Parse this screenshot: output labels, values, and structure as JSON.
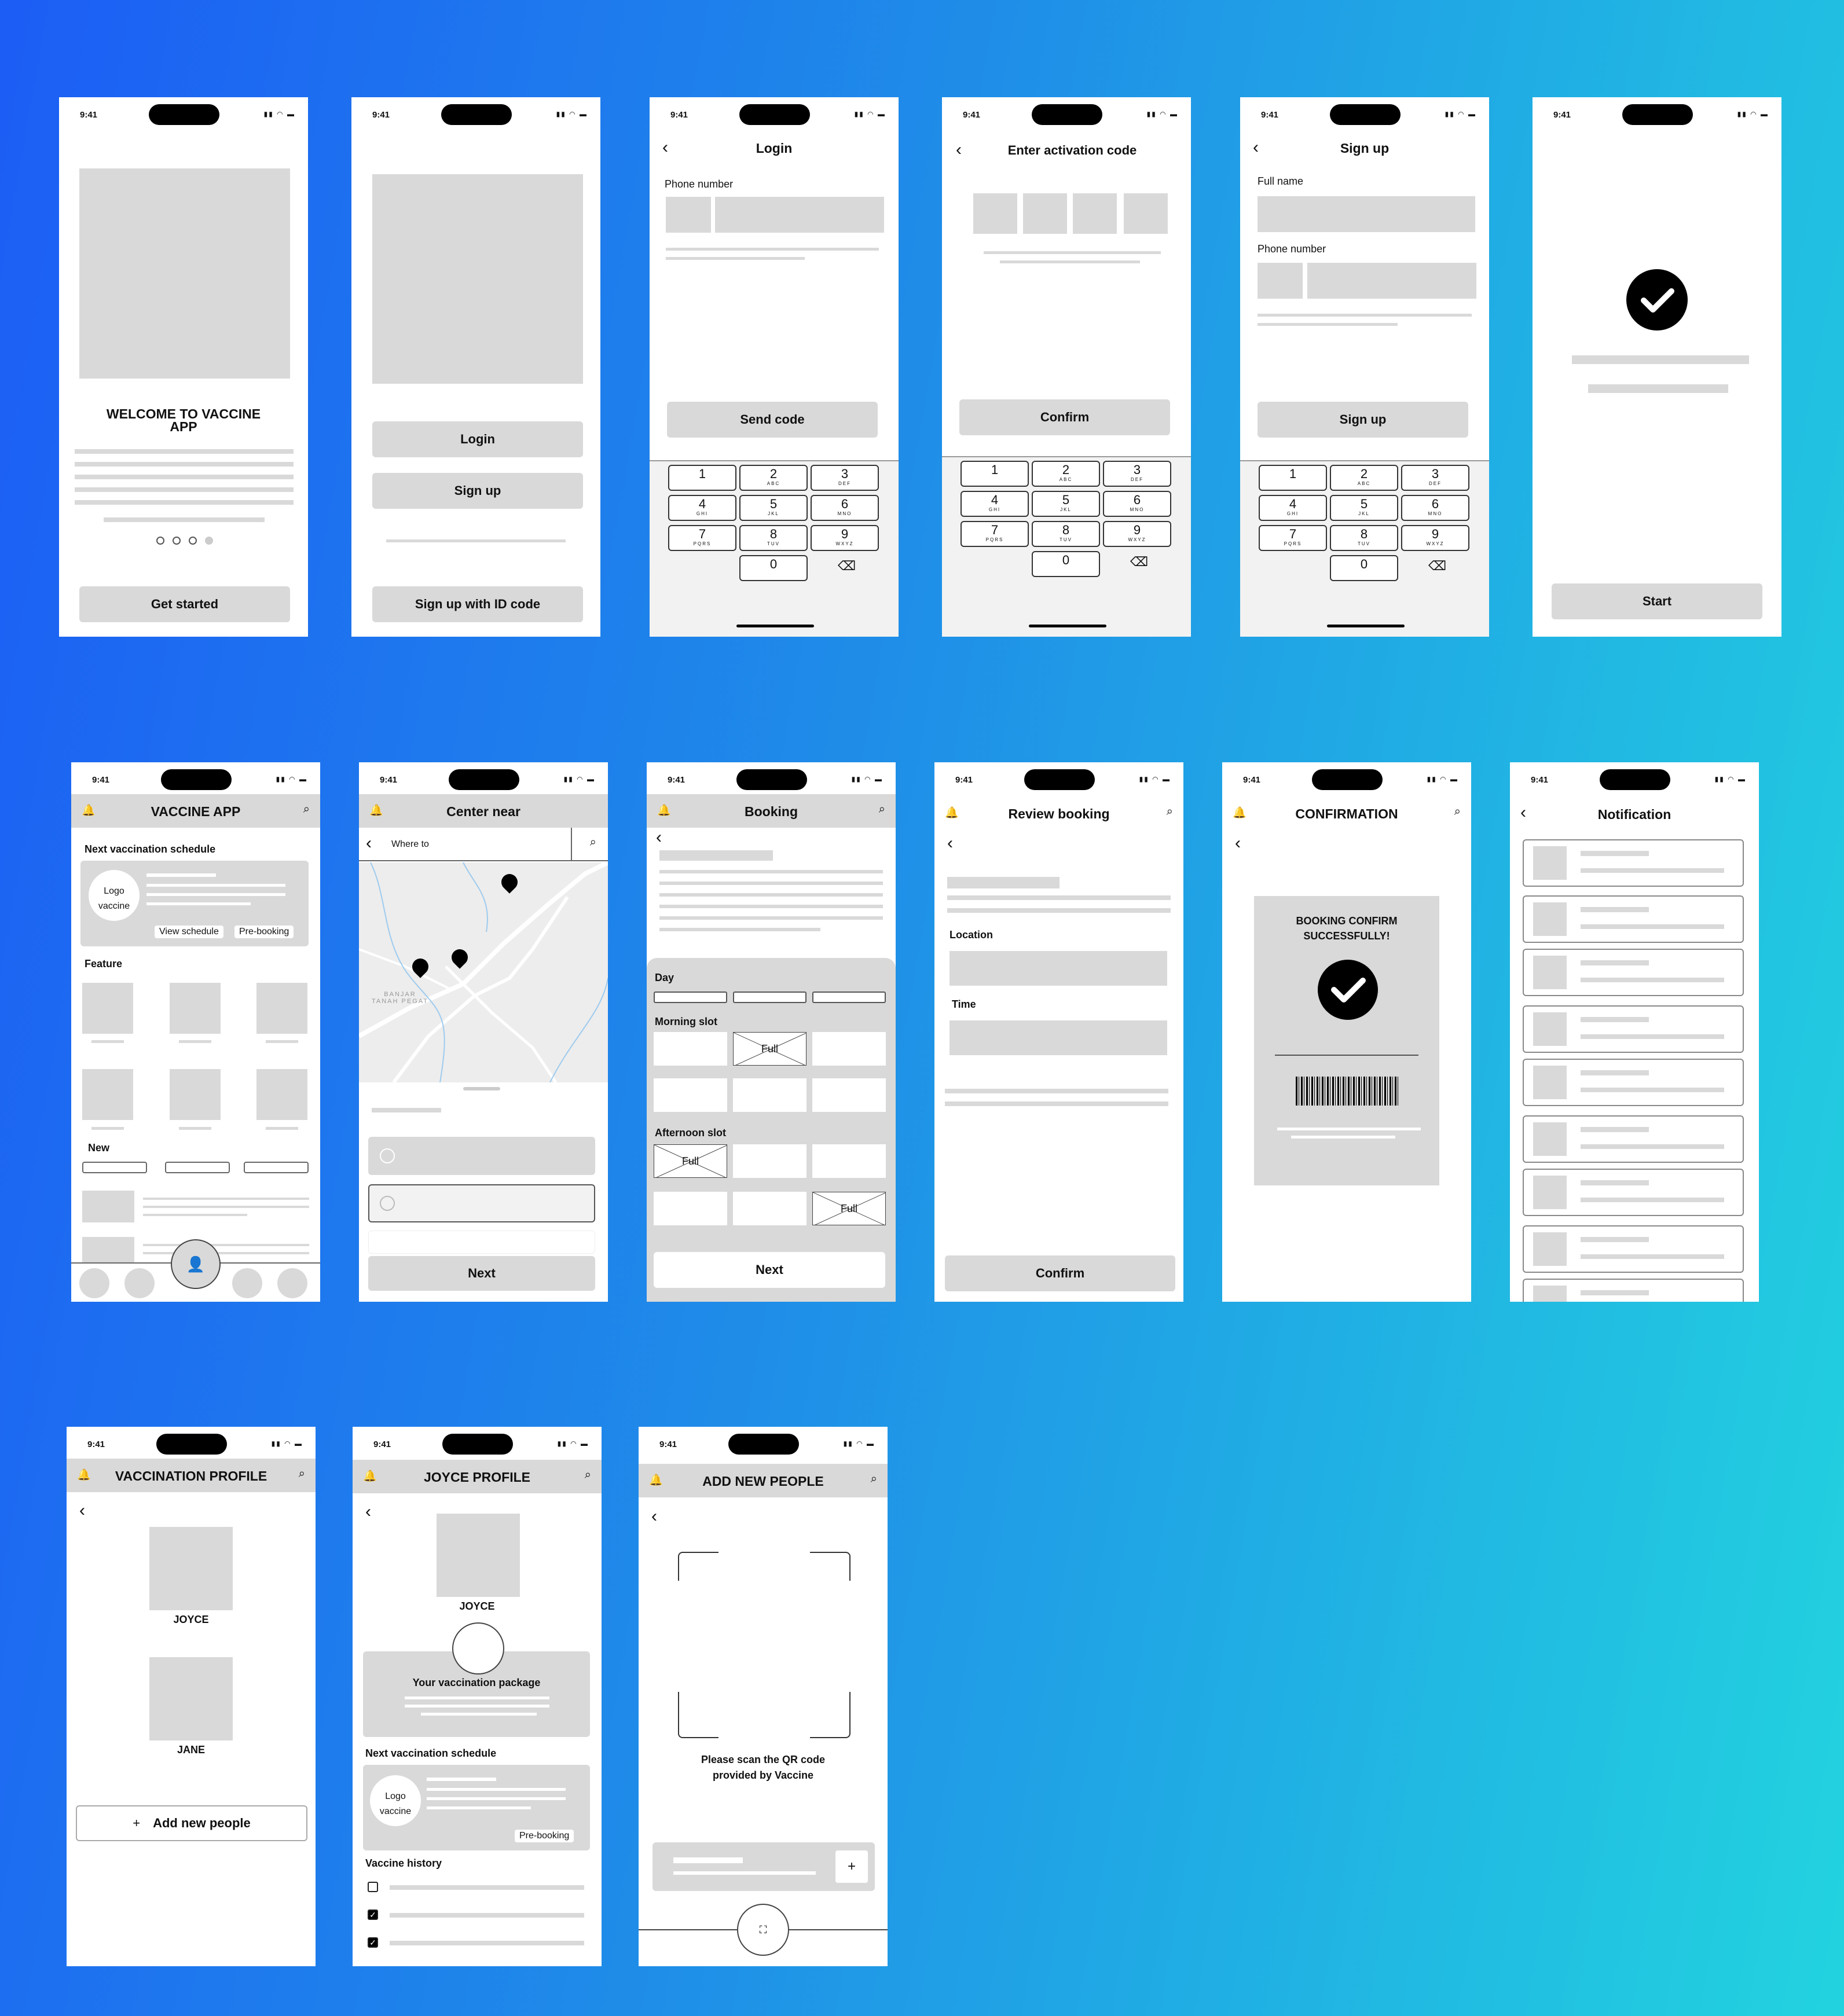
{
  "status": {
    "time": "9:41",
    "icons": "▮▮ ◠ ▬"
  },
  "s1": {
    "title": "WELCOME TO VACCINE APP",
    "button": "Get started"
  },
  "s2": {
    "login": "Login",
    "signup": "Sign up",
    "id_signup": "Sign up with ID code"
  },
  "s3": {
    "title": "Login",
    "phone_label": "Phone number",
    "button": "Send code"
  },
  "s4": {
    "title": "Enter activation code",
    "button": "Confirm"
  },
  "s5": {
    "title": "Sign up",
    "name_label": "Full name",
    "phone_label": "Phone number",
    "button": "Sign up"
  },
  "s6": {
    "button": "Start"
  },
  "keypad": {
    "keys": [
      {
        "n": "1",
        "s": ""
      },
      {
        "n": "2",
        "s": "ABC"
      },
      {
        "n": "3",
        "s": "DEF"
      },
      {
        "n": "4",
        "s": "GHI"
      },
      {
        "n": "5",
        "s": "JKL"
      },
      {
        "n": "6",
        "s": "MNO"
      },
      {
        "n": "7",
        "s": "PQRS"
      },
      {
        "n": "8",
        "s": "TUV"
      },
      {
        "n": "9",
        "s": "WXYZ"
      },
      {
        "n": "0",
        "s": ""
      }
    ],
    "delete": "⌫"
  },
  "s7": {
    "title": "VACCINE APP",
    "schedule_label": "Next vaccination schedule",
    "logo_line1": "Logo",
    "logo_line2": "vaccine",
    "view_schedule": "View schedule",
    "pre_booking": "Pre-booking",
    "feature_label": "Feature",
    "new_label": "New"
  },
  "s8": {
    "title": "Center near",
    "search_placeholder": "Where to",
    "map_label_line1": "BANJAR",
    "map_label_line2": "TANAH PEGAT",
    "button": "Next"
  },
  "s9": {
    "title": "Booking",
    "day_label": "Day",
    "morning_label": "Morning slot",
    "afternoon_label": "Afternoon slot",
    "full": "Full",
    "button": "Next"
  },
  "s10": {
    "title": "Review booking",
    "location_label": "Location",
    "time_label": "Time",
    "button": "Confirm"
  },
  "s11": {
    "title": "CONFIRMATION",
    "message": "BOOKING CONFIRM SUCCESSFULLY!"
  },
  "s12": {
    "title": "Notification"
  },
  "s13": {
    "title": "VACCINATION PROFILE",
    "person1": "JOYCE",
    "person2": "JANE",
    "add_label": "Add new people"
  },
  "s14": {
    "title": "JOYCE PROFILE",
    "name": "JOYCE",
    "package_label": "Your vaccination package",
    "schedule_label": "Next vaccination schedule",
    "logo_line1": "Logo",
    "logo_line2": "vaccine",
    "pre_booking": "Pre-booking",
    "history_label": "Vaccine history"
  },
  "s15": {
    "title": "ADD NEW PEOPLE",
    "scan_line1": "Please scan the QR code",
    "scan_line2": "provided by Vaccine"
  }
}
